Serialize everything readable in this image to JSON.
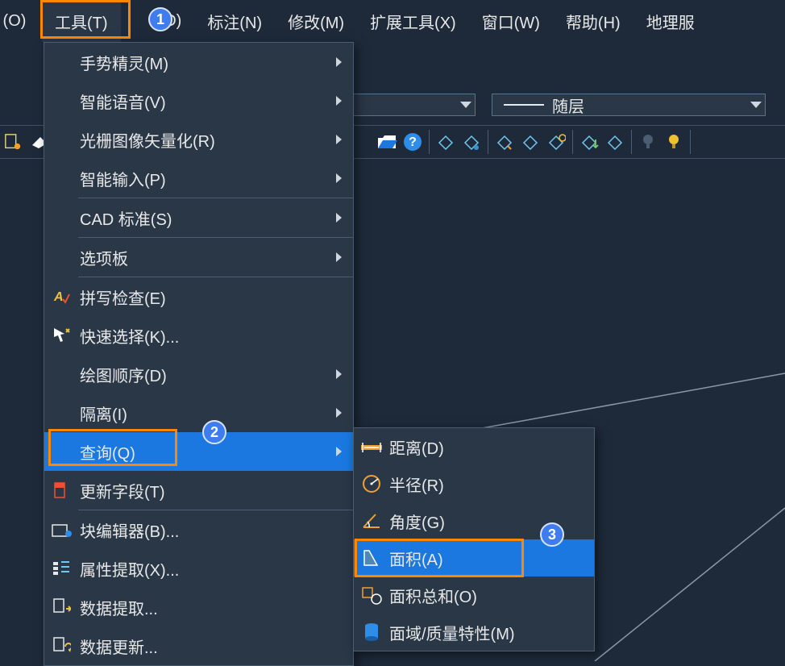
{
  "menubar": {
    "items": [
      "(O)",
      "工具(T)",
      "(D)",
      "标注(N)",
      "修改(M)",
      "扩展工具(X)",
      "窗口(W)",
      "帮助(H)",
      "地理服"
    ],
    "active_index": 1
  },
  "toolbar_layer_combo_label": "随层",
  "tools_menu": {
    "items": [
      {
        "label": "手势精灵(M)",
        "icon": "",
        "has_sub": true
      },
      {
        "label": "智能语音(V)",
        "icon": "",
        "has_sub": true
      },
      {
        "label": "光栅图像矢量化(R)",
        "icon": "",
        "has_sub": true
      },
      {
        "label": "智能输入(P)",
        "icon": "",
        "has_sub": true
      },
      {
        "label": "CAD 标准(S)",
        "icon": "",
        "has_sub": true,
        "divider_before": true
      },
      {
        "label": "选项板",
        "icon": "",
        "has_sub": true,
        "divider_before": true
      },
      {
        "label": "拼写检查(E)",
        "icon": "spell-check-icon",
        "has_sub": false,
        "divider_before": true
      },
      {
        "label": "快速选择(K)...",
        "icon": "quick-select-icon",
        "has_sub": false
      },
      {
        "label": "绘图顺序(D)",
        "icon": "",
        "has_sub": true
      },
      {
        "label": "隔离(I)",
        "icon": "",
        "has_sub": true
      },
      {
        "label": "查询(Q)",
        "icon": "",
        "has_sub": true,
        "selected": true
      },
      {
        "label": "更新字段(T)",
        "icon": "update-field-icon",
        "has_sub": false
      },
      {
        "label": "块编辑器(B)...",
        "icon": "block-editor-icon",
        "has_sub": false,
        "divider_before": true
      },
      {
        "label": "属性提取(X)...",
        "icon": "attr-extract-icon",
        "has_sub": false
      },
      {
        "label": "数据提取...",
        "icon": "data-extract-icon",
        "has_sub": false
      },
      {
        "label": "数据更新...",
        "icon": "data-update-icon",
        "has_sub": false
      }
    ]
  },
  "query_submenu": {
    "items": [
      {
        "label": "距离(D)",
        "icon": "distance-icon"
      },
      {
        "label": "半径(R)",
        "icon": "radius-icon"
      },
      {
        "label": "角度(G)",
        "icon": "angle-icon"
      },
      {
        "label": "面积(A)",
        "icon": "area-icon",
        "selected": true
      },
      {
        "label": "面积总和(O)",
        "icon": "area-sum-icon"
      },
      {
        "label": "面域/质量特性(M)",
        "icon": "region-mass-icon"
      }
    ]
  },
  "annotations": {
    "badge1": "1",
    "badge2": "2",
    "badge3": "3"
  }
}
